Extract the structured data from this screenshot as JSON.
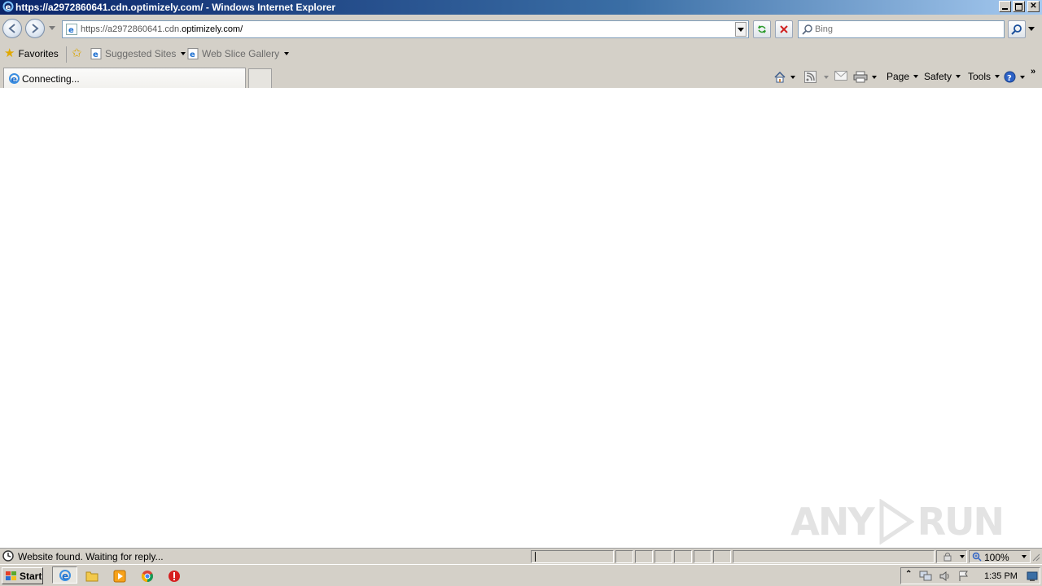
{
  "window": {
    "title": "https://a2972860641.cdn.optimizely.com/ - Windows Internet Explorer"
  },
  "address_bar": {
    "url_prefix": "https://a2972860641.cdn.",
    "url_domain": "optimizely.com/",
    "url": "https://a2972860641.cdn.optimizely.com/"
  },
  "search": {
    "placeholder": "Bing"
  },
  "favorites_bar": {
    "favorites_label": "Favorites",
    "items": [
      {
        "label": "Suggested Sites"
      },
      {
        "label": "Web Slice Gallery"
      }
    ]
  },
  "tabs": [
    {
      "label": "Connecting..."
    }
  ],
  "command_bar": {
    "page_label": "Page",
    "safety_label": "Safety",
    "tools_label": "Tools"
  },
  "status_bar": {
    "text": "Website found. Waiting for reply...",
    "zoom": "100%"
  },
  "taskbar": {
    "start_label": "Start",
    "clock": "1:35 PM"
  },
  "watermark": {
    "text_left": "ANY",
    "text_right": "RUN"
  }
}
